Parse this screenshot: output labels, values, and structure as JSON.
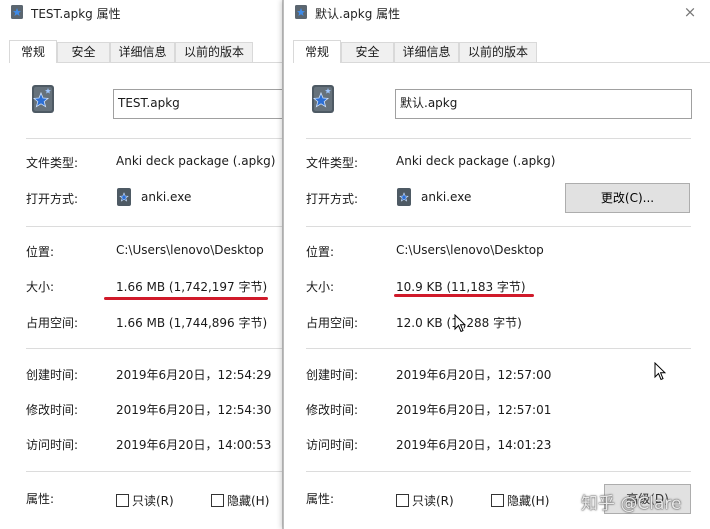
{
  "left_window": {
    "title": "TEST.apkg 属性",
    "tabs": [
      "常规",
      "安全",
      "详细信息",
      "以前的版本"
    ],
    "file_name": "TEST.apkg",
    "labels": {
      "type": "文件类型:",
      "opens_with": "打开方式:",
      "location": "位置:",
      "size": "大小:",
      "size_on_disk": "占用空间:",
      "created": "创建时间:",
      "modified": "修改时间:",
      "accessed": "访问时间:",
      "attributes": "属性:"
    },
    "values": {
      "type": "Anki deck package (.apkg)",
      "opens_with": "anki.exe",
      "location": "C:\\Users\\lenovo\\Desktop",
      "size": "1.66 MB (1,742,197 字节)",
      "size_on_disk": "1.66 MB (1,744,896 字节)",
      "created": "2019年6月20日，12:54:29",
      "modified": "2019年6月20日，12:54:30",
      "accessed": "2019年6月20日，14:00:53"
    },
    "checkboxes": {
      "readonly": "只读(R)",
      "hidden": "隐藏(H)"
    }
  },
  "right_window": {
    "title": "默认.apkg 属性",
    "close_glyph": "×",
    "tabs": [
      "常规",
      "安全",
      "详细信息",
      "以前的版本"
    ],
    "file_name": "默认.apkg",
    "labels": {
      "type": "文件类型:",
      "opens_with": "打开方式:",
      "location": "位置:",
      "size": "大小:",
      "size_on_disk": "占用空间:",
      "created": "创建时间:",
      "modified": "修改时间:",
      "accessed": "访问时间:",
      "attributes": "属性:"
    },
    "values": {
      "type": "Anki deck package (.apkg)",
      "opens_with": "anki.exe",
      "location": "C:\\Users\\lenovo\\Desktop",
      "size": "10.9 KB (11,183 字节)",
      "size_on_disk": "12.0 KB (1 ,288 字节)",
      "created": "2019年6月20日，12:57:00",
      "modified": "2019年6月20日，12:57:01",
      "accessed": "2019年6月20日，14:01:23"
    },
    "change_button": "更改(C)...",
    "checkboxes": {
      "readonly": "只读(R)",
      "hidden": "隐藏(H)"
    },
    "advanced_button_partial": "高级(D)"
  },
  "watermark": "知乎 @Clare",
  "colors": {
    "annotation_underline": "#d01a2a",
    "anki_icon_blue": "#2d6fd4"
  }
}
